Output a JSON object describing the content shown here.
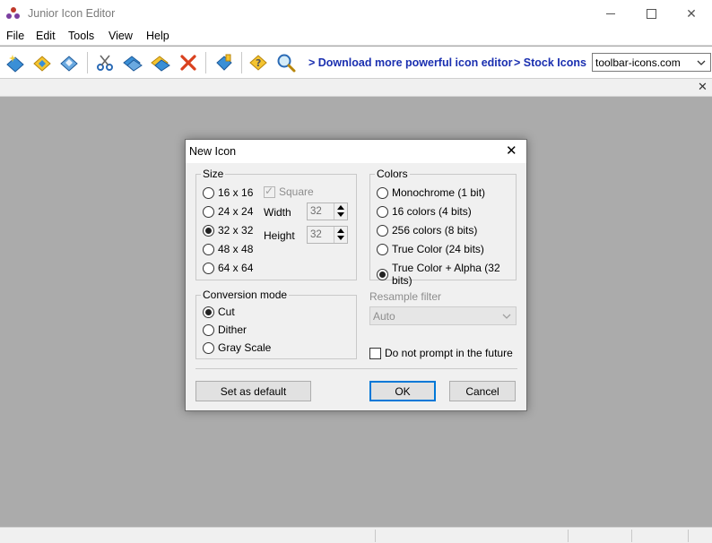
{
  "window": {
    "title": "Junior Icon Editor"
  },
  "menu": [
    "File",
    "Edit",
    "Tools",
    "View",
    "Help"
  ],
  "toolbar": {
    "links": [
      "> Download more powerful icon editor",
      "> Stock Icons"
    ],
    "site_select_value": "toolbar-icons.com"
  },
  "dialog": {
    "title": "New Icon",
    "size": {
      "legend": "Size",
      "options": [
        "16 x 16",
        "24 x 24",
        "32 x 32",
        "48 x 48",
        "64 x 64"
      ],
      "selected": "32 x 32",
      "square_label": "Square",
      "square_checked": true,
      "width_label": "Width",
      "width_value": "32",
      "height_label": "Height",
      "height_value": "32"
    },
    "colors": {
      "legend": "Colors",
      "options": [
        "Monochrome (1 bit)",
        "16 colors (4 bits)",
        "256 colors (8 bits)",
        "True Color (24 bits)",
        "True Color + Alpha (32 bits)"
      ],
      "selected": "True Color + Alpha (32 bits)"
    },
    "conversion": {
      "legend": "Conversion mode",
      "options": [
        "Cut",
        "Dither",
        "Gray Scale"
      ],
      "selected": "Cut"
    },
    "resample": {
      "label": "Resample filter",
      "value": "Auto"
    },
    "no_prompt_label": "Do not prompt in the future",
    "buttons": {
      "set_default": "Set as default",
      "ok": "OK",
      "cancel": "Cancel"
    }
  },
  "colors": {
    "workspace": "#ababab",
    "link": "#1a2fb0",
    "focus": "#0078d7"
  }
}
